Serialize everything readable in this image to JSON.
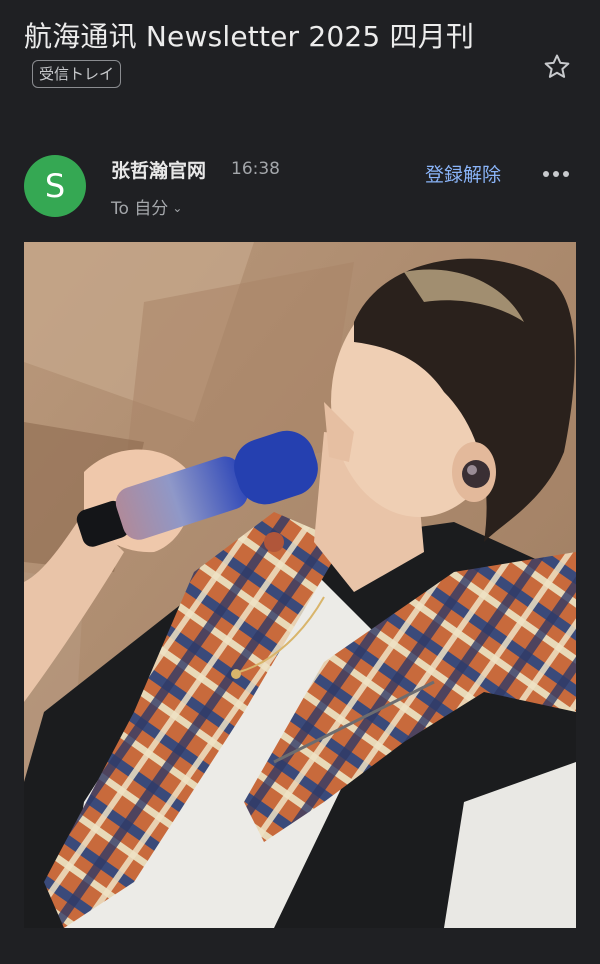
{
  "email": {
    "subject": "航海通讯 Newsletter 2025 四月刊",
    "label": "受信トレイ",
    "starred": false,
    "sender": {
      "name": "张哲瀚官网",
      "avatar_initial": "S",
      "avatar_color": "#35a853",
      "time": "16:38",
      "recipients": "To 自分"
    },
    "unsubscribe_label": "登録解除",
    "accent_color": "#8ab4f8"
  },
  "icons": {
    "star": "star-outline-icon",
    "more": "more-horizontal-icon",
    "chevron": "chevron-down-icon"
  }
}
